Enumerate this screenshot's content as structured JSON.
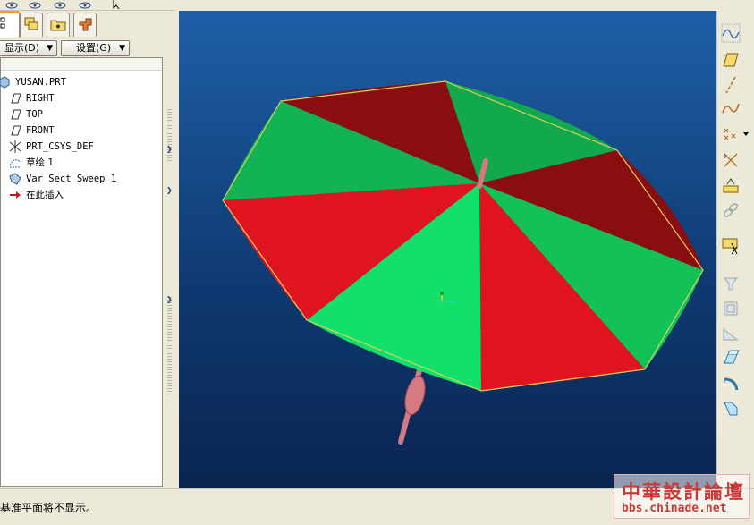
{
  "toolbar": {
    "display_menu": "显示(D)",
    "settings_menu": "设置(G)"
  },
  "tree": {
    "items": [
      {
        "label": "YUSAN.PRT",
        "icon": "part-icon"
      },
      {
        "label": "RIGHT",
        "icon": "datum-plane-icon"
      },
      {
        "label": "TOP",
        "icon": "datum-plane-icon"
      },
      {
        "label": "FRONT",
        "icon": "datum-plane-icon"
      },
      {
        "label": "PRT_CSYS_DEF",
        "icon": "csys-icon"
      },
      {
        "label": "草绘 1",
        "icon": "sketch-icon"
      },
      {
        "label": "Var Sect Sweep 1",
        "icon": "sweep-icon"
      },
      {
        "label": "在此插入",
        "icon": "insert-here-arrow-icon"
      }
    ]
  },
  "status": {
    "message": "基准平面将不显示。"
  },
  "watermark": {
    "logo": "中華設計論壇",
    "url": "bbs.chinade.net"
  },
  "colors": {
    "viewport_bg": "#1e5fa7",
    "umbrella_red": "#e0141e",
    "umbrella_green": "#12c257",
    "umbrella_dark_red": "#8a0d10",
    "handle": "#d67a82"
  }
}
